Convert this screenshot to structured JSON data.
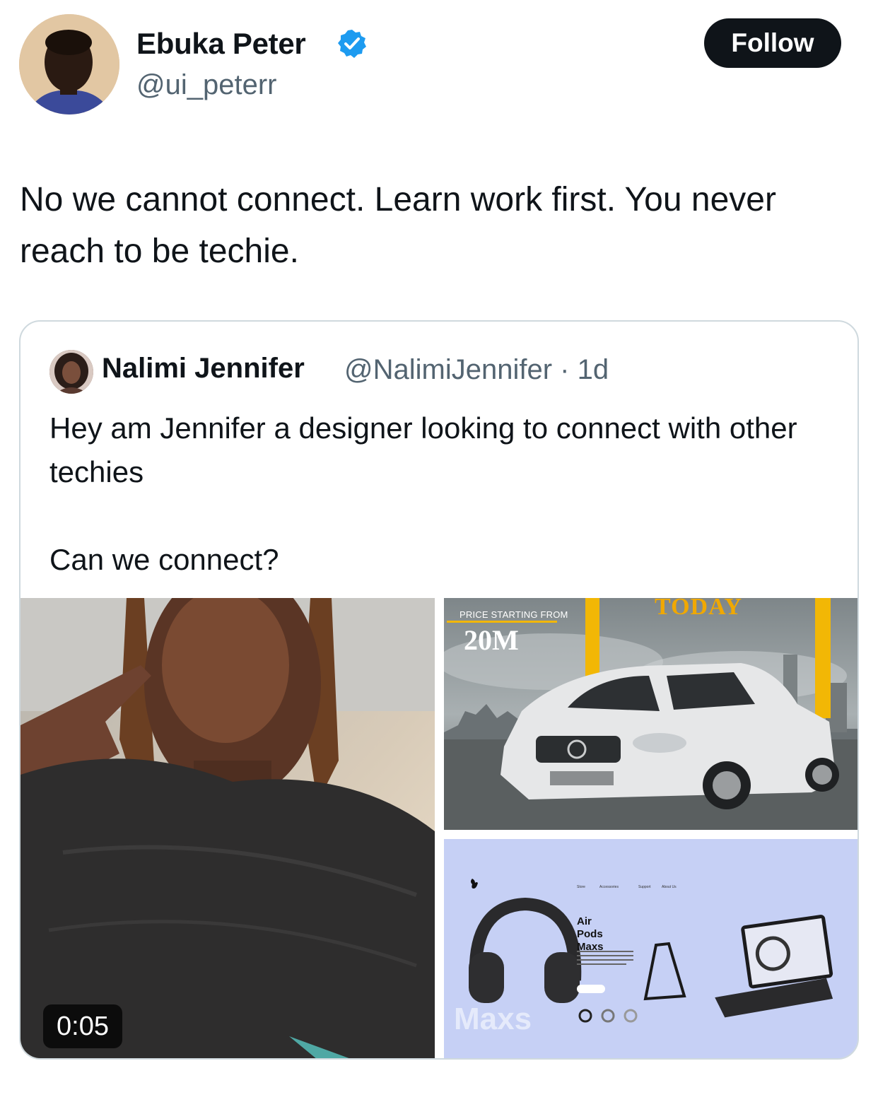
{
  "author": {
    "name": "Ebuka Peter",
    "handle": "@ui_peterr",
    "verified": true
  },
  "follow_label": "Follow",
  "tweet_text": "No we cannot connect. Learn work first. You never reach to be techie.",
  "quote": {
    "name": "Nalimi Jennifer",
    "meta": "@NalimiJennifer · 1d",
    "text_line1": "Hey am Jennifer a designer looking to connect with other techies",
    "text_line2": "Can we connect?",
    "video_duration": "0:05",
    "car_ad": {
      "price_label": "PRICE STARTING FROM",
      "price_value": "20M",
      "headline": "TODAY"
    },
    "airpods_ad": {
      "nav": [
        "Store",
        "Accessories",
        "Support",
        "About Us"
      ],
      "title": "Air Pods Maxs",
      "ghost_text": "Maxs"
    }
  },
  "colors": {
    "text_primary": "#0f1419",
    "text_secondary": "#536471",
    "verified_blue": "#1d9bf0",
    "follow_bg": "#0f1419",
    "card_border": "#cfd9de"
  }
}
